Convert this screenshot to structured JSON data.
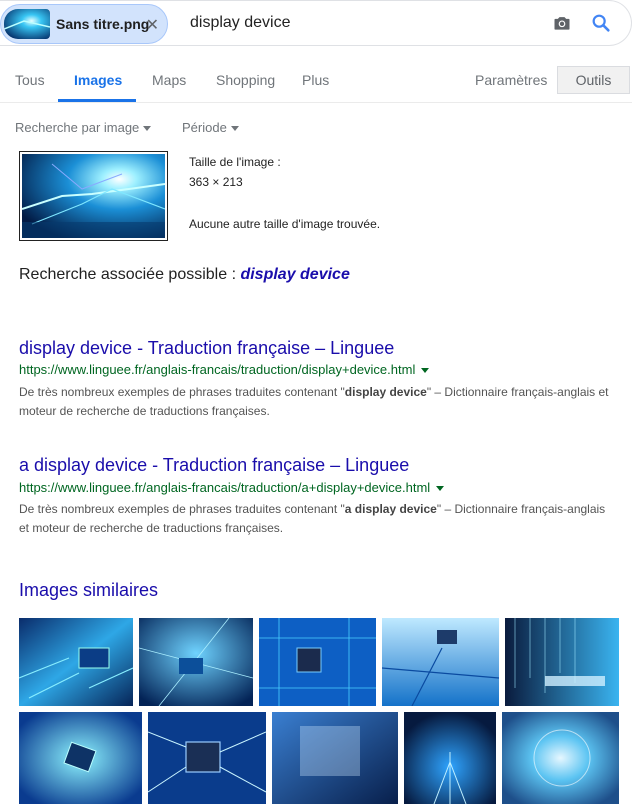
{
  "search": {
    "chip_label": "Sans titre.png",
    "query": "display device"
  },
  "tabs": [
    {
      "label": "Tous"
    },
    {
      "label": "Images"
    },
    {
      "label": "Maps"
    },
    {
      "label": "Shopping"
    },
    {
      "label": "Plus"
    }
  ],
  "settings_label": "Paramètres",
  "tools_label": "Outils",
  "filters": {
    "search_by_image": "Recherche par image",
    "period": "Période"
  },
  "image_info": {
    "size_label": "Taille de l'image :",
    "size_value": "363 × 213",
    "no_other_sizes": "Aucune autre taille d'image trouvée."
  },
  "related": {
    "prefix": "Recherche associée possible : ",
    "link": "display device"
  },
  "results": [
    {
      "title": "display device - Traduction française – Linguee",
      "url": "https://www.linguee.fr/anglais-francais/traduction/display+device.html",
      "snippet_before": "De très nombreux exemples de phrases traduites contenant \"",
      "snippet_bold": "display device",
      "snippet_after": "\" – Dictionnaire français-anglais et moteur de recherche de traductions françaises."
    },
    {
      "title": "a display device - Traduction française – Linguee",
      "url": "https://www.linguee.fr/anglais-francais/traduction/a+display+device.html",
      "snippet_before": "De très nombreux exemples de phrases traduites contenant \"",
      "snippet_bold": "a display device",
      "snippet_after": "\" – Dictionnaire français-anglais et moteur de recherche de traductions françaises."
    }
  ],
  "similar_title": "Images similaires",
  "colors": {
    "link": "#1a0dab",
    "url": "#006621",
    "accent": "#1a73e8"
  }
}
